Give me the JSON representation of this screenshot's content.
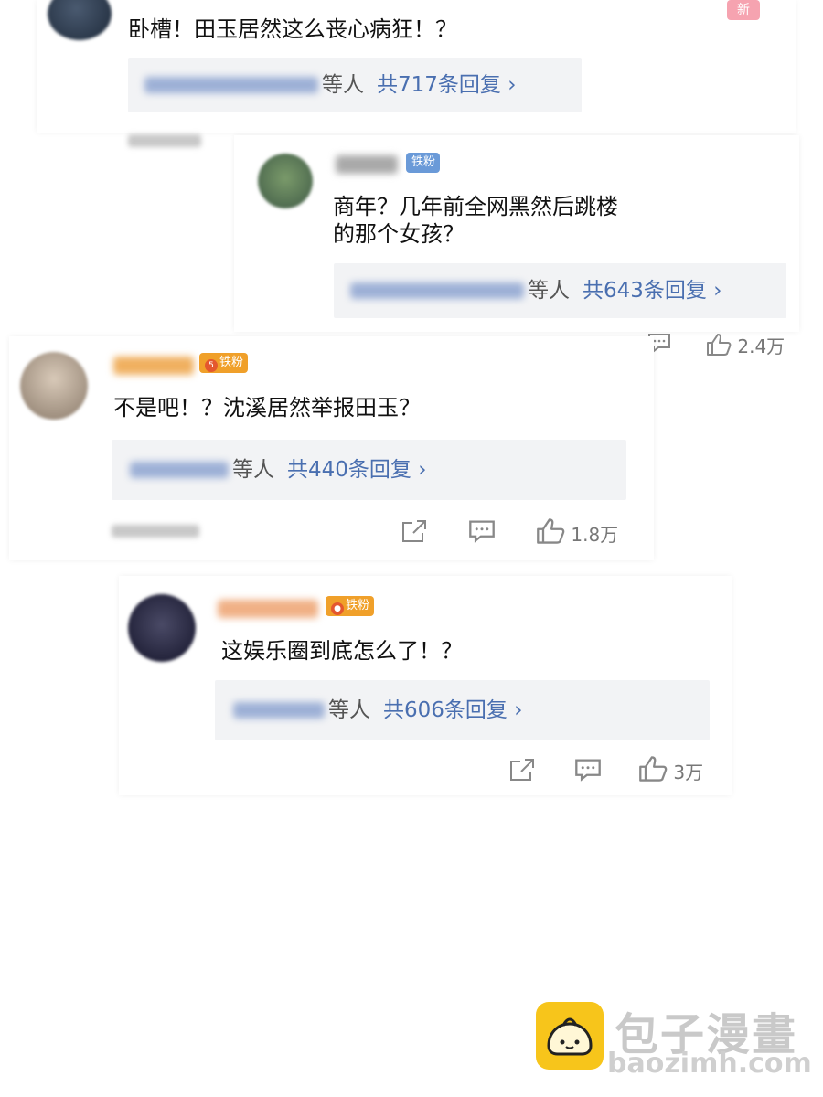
{
  "comment1": {
    "text": "卧槽！田玉居然这么丧心病狂！？",
    "reply_suffix": "等人",
    "reply_count": "共717条回复 ›",
    "new_badge": "新"
  },
  "comment2": {
    "badge": "铁粉",
    "text_line1": "商年？几年前全网黑然后跳楼",
    "text_line2": "的那个女孩？",
    "reply_suffix": "等人",
    "reply_count": "共643条回复 ›",
    "likes": "2.4万"
  },
  "comment3": {
    "badge": "铁粉",
    "badge_level": "5",
    "text": "不是吧！？沈溪居然举报田玉？",
    "reply_suffix": "等人",
    "reply_count": "共440条回复 ›",
    "likes": "1.8万"
  },
  "comment4": {
    "badge": "铁粉",
    "text": "这娱乐圈到底怎么了！？",
    "reply_suffix": "等人",
    "reply_count": "共606条回复 ›",
    "likes": "3万"
  },
  "watermark": {
    "title": "包子漫畫",
    "url": "baozimh.com"
  },
  "icons": [
    "share-icon",
    "comment-icon",
    "like-icon"
  ],
  "colors": {
    "link_blue": "#4a6fb0",
    "badge_blue": "#6a9ad8",
    "badge_orange": "#f0a02a",
    "reply_bg": "#f2f3f5"
  }
}
